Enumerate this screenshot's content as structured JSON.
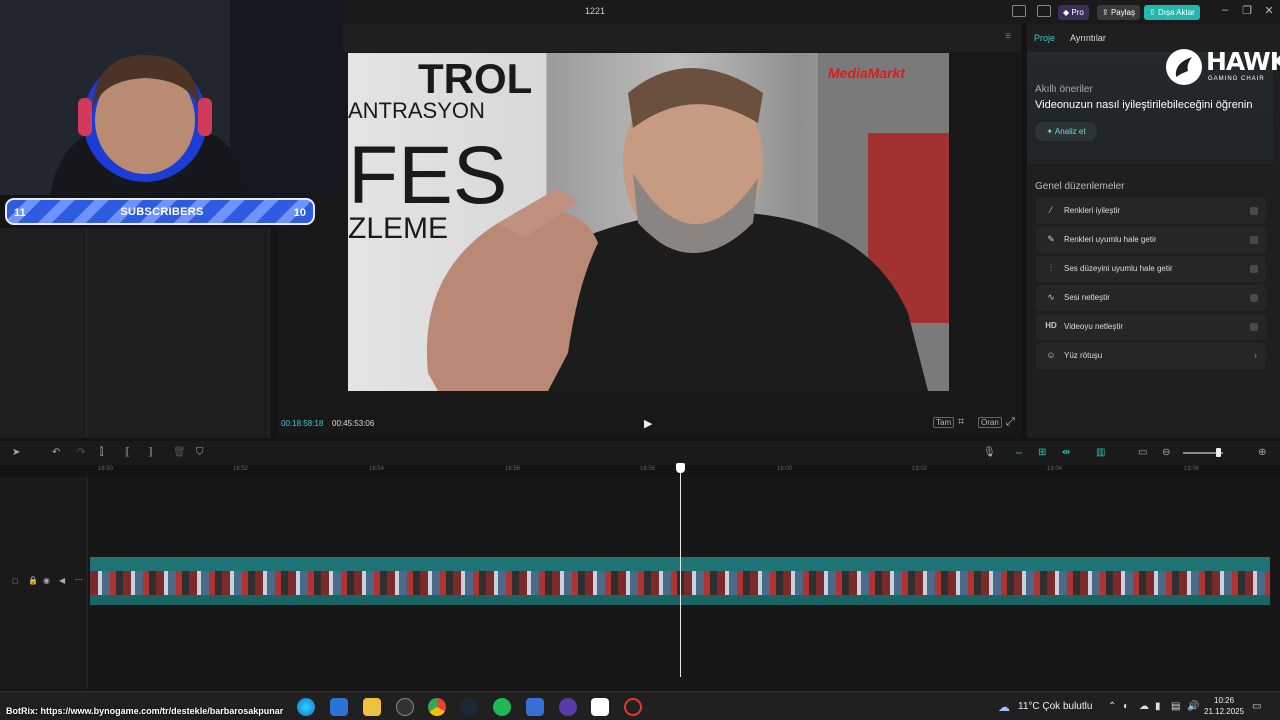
{
  "titlebar": {
    "title": "1221",
    "pro_label": "Pro",
    "share_label": "Paylaş",
    "export_label": "Dışa Aktar",
    "accent": "#2ec4b6"
  },
  "stream_overlay": {
    "subscribers_label": "SUBSCRIBERS",
    "left_count": "11",
    "right_count": "10",
    "botrix_text": "BotRix: https://www.bynogame.com/tr/destekle/barbarosakpunar"
  },
  "player": {
    "current_time": "00:18:58:18",
    "total_time": "00:45:53:06",
    "controls": [
      "Tam",
      "Oran"
    ],
    "video_sign_texts": [
      "TROL",
      "ANTRASYON",
      "FES",
      "ZLEME",
      "MediaMarkt"
    ]
  },
  "right_panel": {
    "tabs": [
      "Proje",
      "Ayrıntılar"
    ],
    "smart_title": "Akıllı öneriler",
    "smart_desc": "Videonuzun nasıl iyileştirilebileceğini öğrenin",
    "analyze_label": "Analiz et",
    "general_title": "Genel düzenlemeler",
    "options": [
      {
        "icon": "magic-wand-icon",
        "label": "Renkleri iyileştir"
      },
      {
        "icon": "color-match-icon",
        "label": "Renkleri uyumlu hale getir"
      },
      {
        "icon": "audio-levels-icon",
        "label": "Ses düzeyini uyumlu hale getir"
      },
      {
        "icon": "waveform-icon",
        "label": "Sesi netleştir"
      },
      {
        "icon": "hd-icon",
        "label": "Videoyu netleştir"
      },
      {
        "icon": "face-retouch-icon",
        "label": "Yüz rötuşu"
      }
    ]
  },
  "hawk_logo": {
    "title": "HAWK",
    "subtitle": "GAMING CHAIR"
  },
  "timeline": {
    "ticks": [
      "18:50",
      "18:52",
      "18:54",
      "18:56",
      "18:58",
      "19:00",
      "19:02",
      "19:04",
      "19:06"
    ]
  },
  "taskbar": {
    "weather": "11°C  Çok bulutlu",
    "time": "10:26",
    "date": "21.12.2025"
  }
}
